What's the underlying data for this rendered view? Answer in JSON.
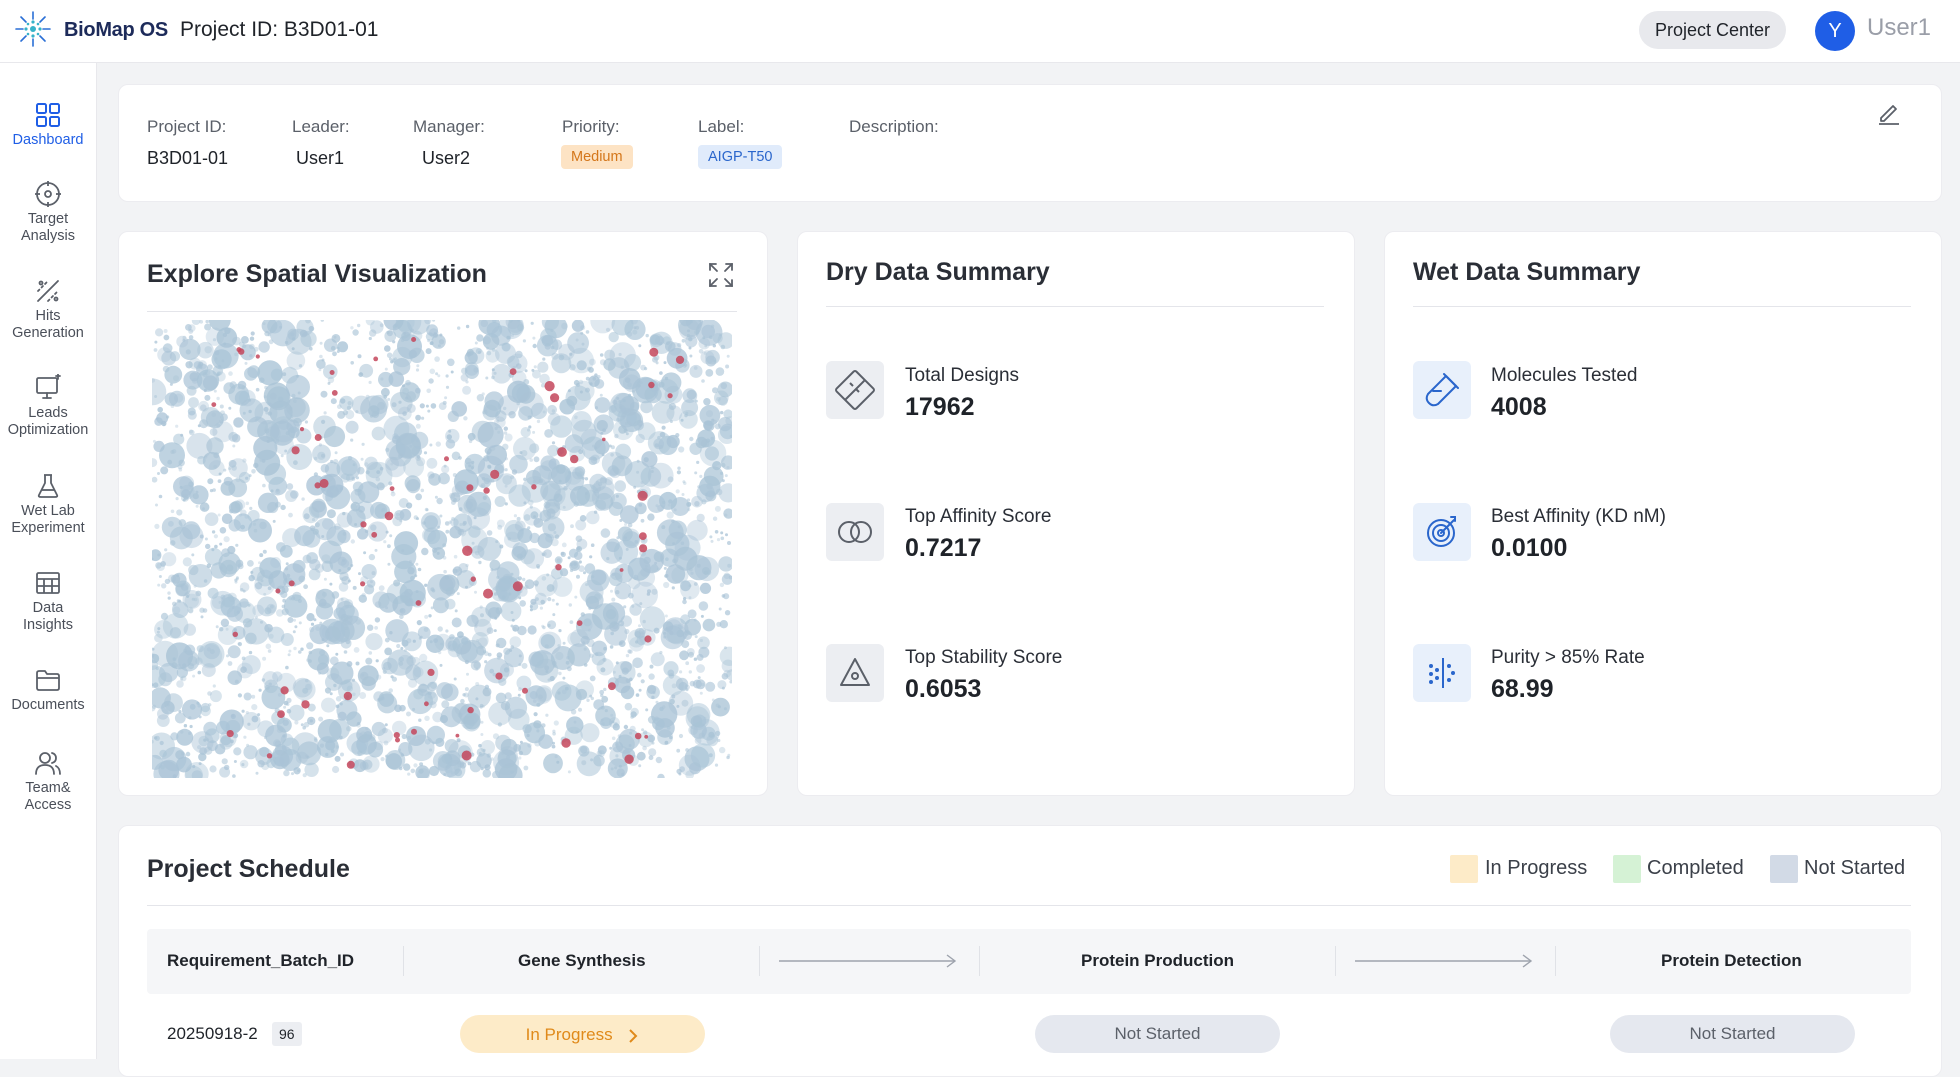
{
  "header": {
    "brand": "BioMap OS",
    "project_title": "Project ID: B3D01-01",
    "project_center": "Project Center",
    "avatar_initial": "Y",
    "user_name": "User1"
  },
  "sidebar": {
    "items": [
      {
        "label": "Dashboard",
        "icon": "dashboard-icon",
        "active": true
      },
      {
        "label": "Target\nAnalysis",
        "icon": "target-icon"
      },
      {
        "label": "Hits\nGeneration",
        "icon": "hits-icon"
      },
      {
        "label": "Leads\nOptimization",
        "icon": "monitor-icon"
      },
      {
        "label": "Wet Lab\nExperiment",
        "icon": "flask-icon"
      },
      {
        "label": "Data\nInsights",
        "icon": "table-icon"
      },
      {
        "label": "Documents",
        "icon": "folder-icon"
      },
      {
        "label": "Team&\nAccess",
        "icon": "team-icon"
      }
    ]
  },
  "project_info": {
    "id_label": "Project ID:",
    "id_value": "B3D01-01",
    "leader_label": "Leader:",
    "leader_value": "User1",
    "manager_label": "Manager:",
    "manager_value": "User2",
    "priority_label": "Priority:",
    "priority_value": "Medium",
    "label_label": "Label:",
    "label_value": "AIGP-T50",
    "description_label": "Description:"
  },
  "spatial": {
    "title": "Explore Spatial Visualization"
  },
  "dry": {
    "title": "Dry Data Summary",
    "metrics": [
      {
        "label": "Total Designs",
        "value": "17962"
      },
      {
        "label": "Top Affinity Score",
        "value": "0.7217"
      },
      {
        "label": "Top Stability Score",
        "value": "0.6053"
      }
    ]
  },
  "wet": {
    "title": "Wet Data Summary",
    "metrics": [
      {
        "label": "Molecules Tested",
        "value": "4008"
      },
      {
        "label": "Best Affinity (KD nM)",
        "value": "0.0100"
      },
      {
        "label": "Purity > 85% Rate",
        "value": "68.99"
      }
    ]
  },
  "schedule": {
    "title": "Project Schedule",
    "legend": [
      {
        "label": "In Progress",
        "color": "#fdebc8"
      },
      {
        "label": "Completed",
        "color": "#d5f2d5"
      },
      {
        "label": "Not Started",
        "color": "#d2dae6"
      }
    ],
    "columns": {
      "batch": "Requirement_Batch_ID",
      "gene": "Gene Synthesis",
      "production": "Protein Production",
      "detection": "Protein Detection"
    },
    "rows": [
      {
        "batch_id": "20250918-2",
        "count": "96",
        "gene": "In Progress",
        "production": "Not Started",
        "detection": "Not Started"
      }
    ]
  },
  "colors": {
    "accent": "#1f5ee6",
    "in_progress_bg": "#fdebc8",
    "in_progress_text": "#e08a1a",
    "not_started_bg": "#e5e8ef",
    "point_blue": "#a9c3d6",
    "point_red": "#c4475c"
  }
}
